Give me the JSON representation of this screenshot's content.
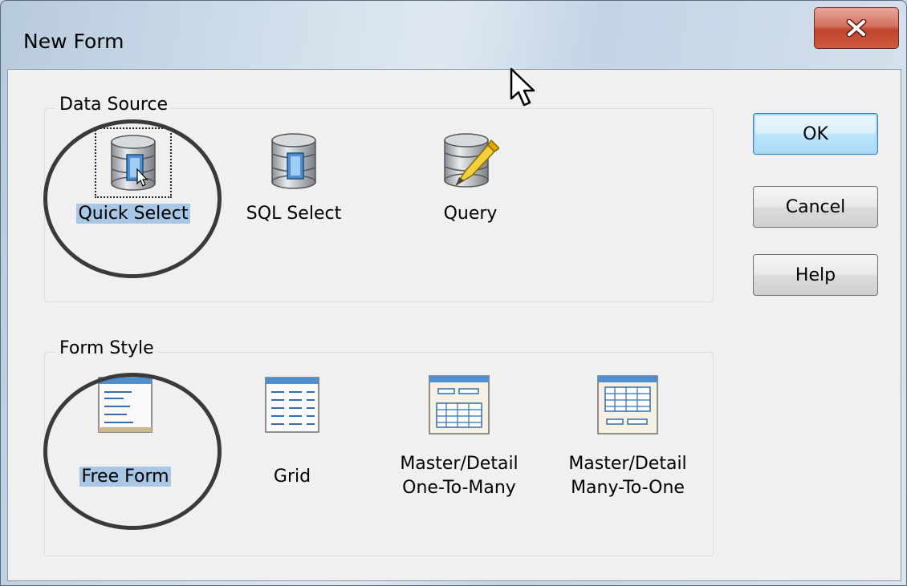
{
  "window": {
    "title": "New Form"
  },
  "data_source": {
    "label": "Data Source",
    "options": [
      {
        "label": "Quick Select",
        "icon": "database-select-icon",
        "selected": true
      },
      {
        "label": "SQL Select",
        "icon": "database-sql-icon",
        "selected": false
      },
      {
        "label": "Query",
        "icon": "database-query-icon",
        "selected": false
      }
    ]
  },
  "form_style": {
    "label": "Form Style",
    "options": [
      {
        "label": "Free Form",
        "icon": "free-form-icon",
        "selected": true
      },
      {
        "label": "Grid",
        "icon": "grid-icon",
        "selected": false
      },
      {
        "label_line1": "Master/Detail",
        "label_line2": "One-To-Many",
        "icon": "master-detail-one-to-many-icon",
        "selected": false
      },
      {
        "label_line1": "Master/Detail",
        "label_line2": "Many-To-One",
        "icon": "master-detail-many-to-one-icon",
        "selected": false
      }
    ]
  },
  "buttons": {
    "ok": "OK",
    "cancel": "Cancel",
    "help": "Help"
  },
  "colors": {
    "selection": "#a8c6e5",
    "close_button": "#c0442d",
    "default_button_border": "#3c7fb1"
  }
}
